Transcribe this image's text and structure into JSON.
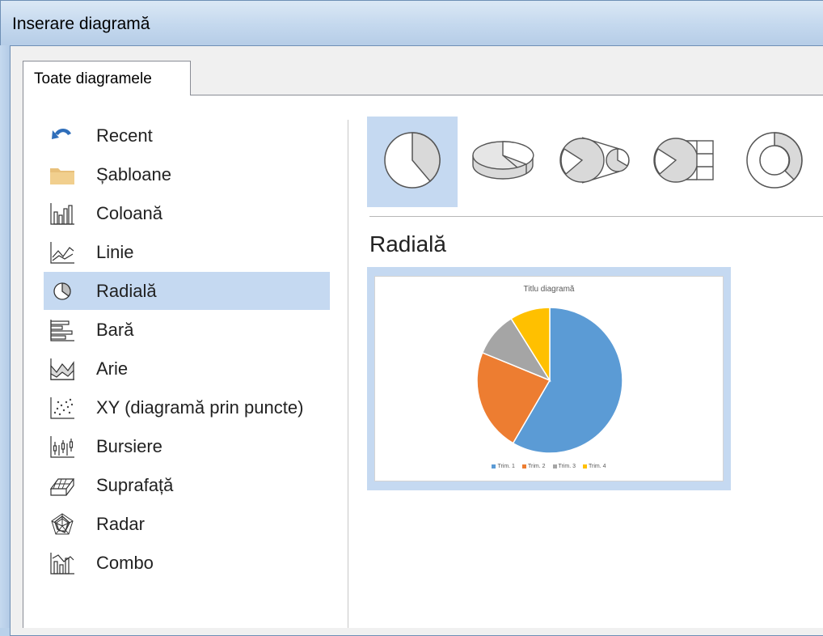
{
  "window": {
    "title": "Inserare diagramă"
  },
  "tabs": [
    {
      "label": "Toate diagramele",
      "active": true
    }
  ],
  "sidebar": {
    "items": [
      {
        "label": "Recent",
        "icon": "recent-icon"
      },
      {
        "label": "Șabloane",
        "icon": "folder-icon"
      },
      {
        "label": "Coloană",
        "icon": "column-chart-icon"
      },
      {
        "label": "Linie",
        "icon": "line-chart-icon"
      },
      {
        "label": "Radială",
        "icon": "pie-chart-icon",
        "selected": true
      },
      {
        "label": "Bară",
        "icon": "bar-chart-icon"
      },
      {
        "label": "Arie",
        "icon": "area-chart-icon"
      },
      {
        "label": "XY (diagramă prin puncte)",
        "icon": "scatter-chart-icon"
      },
      {
        "label": "Bursiere",
        "icon": "stock-chart-icon"
      },
      {
        "label": "Suprafață",
        "icon": "surface-chart-icon"
      },
      {
        "label": "Radar",
        "icon": "radar-chart-icon"
      },
      {
        "label": "Combo",
        "icon": "combo-chart-icon"
      }
    ]
  },
  "subtypes": [
    {
      "icon": "pie-2d-icon",
      "selected": true
    },
    {
      "icon": "pie-3d-icon"
    },
    {
      "icon": "pie-of-pie-icon"
    },
    {
      "icon": "bar-of-pie-icon"
    },
    {
      "icon": "doughnut-icon"
    }
  ],
  "main": {
    "section_title": "Radială"
  },
  "chart_data": {
    "type": "pie",
    "title": "Titlu diagramă",
    "categories": [
      "1",
      "2",
      "3",
      "4"
    ],
    "legend_labels": [
      "Trim. 1",
      "Trim. 2",
      "Trim. 3",
      "Trim. 4"
    ],
    "values": [
      59,
      23,
      10,
      9
    ],
    "colors": [
      "#5b9bd5",
      "#ed7d31",
      "#a5a5a5",
      "#ffc000"
    ],
    "legend": "bottom"
  },
  "colors": {
    "selection": "#c5d9f1",
    "accent": "#4472c4"
  }
}
